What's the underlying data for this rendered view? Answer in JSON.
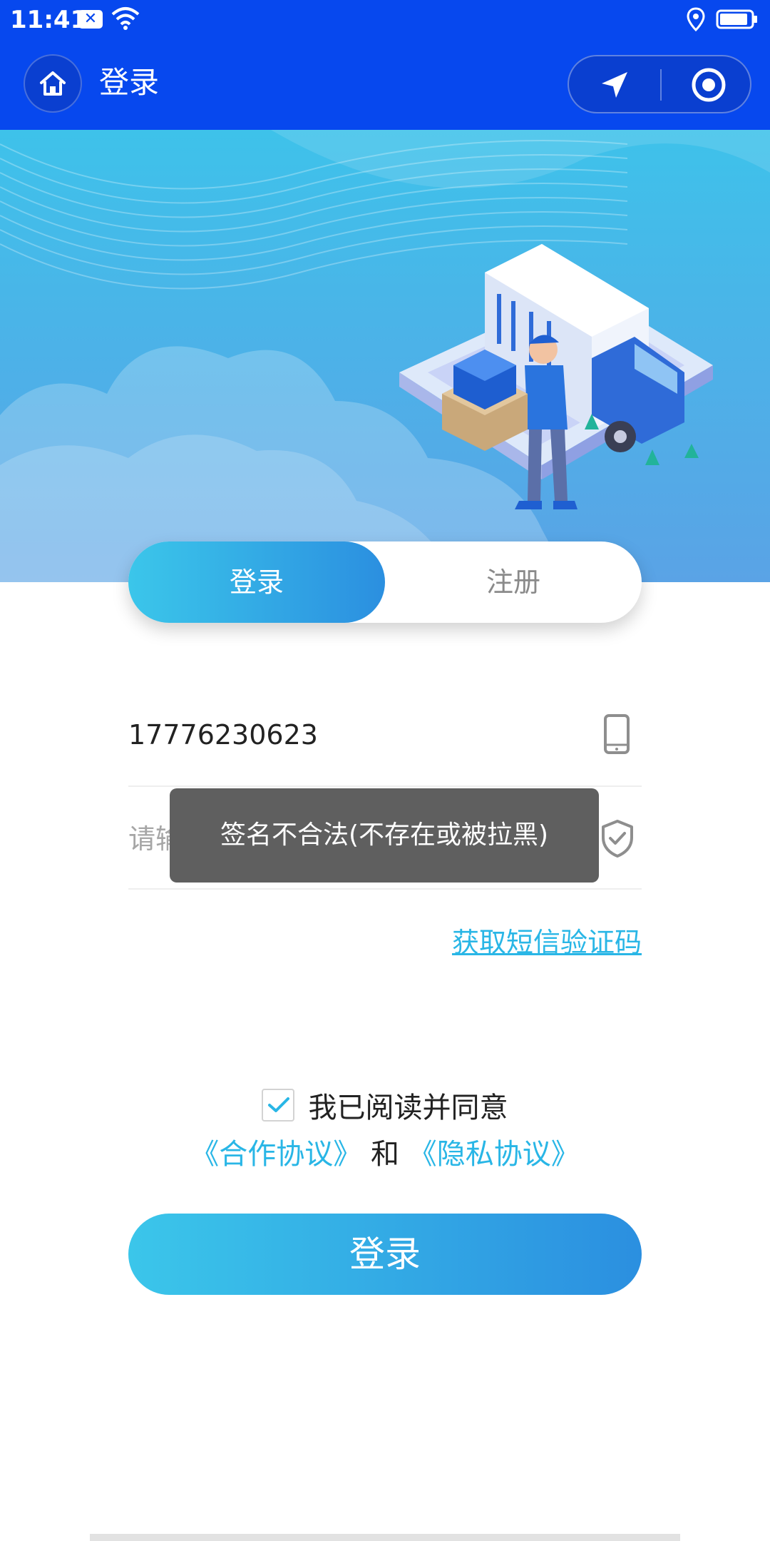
{
  "status_bar": {
    "time": "11:41",
    "x_badge": "✕"
  },
  "nav": {
    "title": "登录",
    "home_icon": "home-icon",
    "location_icon": "navigation-arrow-icon",
    "target_icon": "target-icon"
  },
  "tabs": {
    "login": "登录",
    "register": "注册",
    "active": "login"
  },
  "form": {
    "phone_value": "17776230623",
    "code_placeholder": "请输入短信验证码",
    "sms_link": "获取短信验证码"
  },
  "toast": {
    "message": "签名不合法(不存在或被拉黑)"
  },
  "agreement": {
    "checked": true,
    "text": "我已阅读并同意",
    "cooperation": "《合作协议》",
    "and": "和",
    "privacy": "《隐私协议》"
  },
  "login_button": "登录",
  "colors": {
    "bar_blue": "#0748ee",
    "accent": "#29b6e6",
    "gradient_start": "#3bc6ea",
    "gradient_end": "#2b8fe0",
    "toast_bg": "#5f5f5f"
  }
}
